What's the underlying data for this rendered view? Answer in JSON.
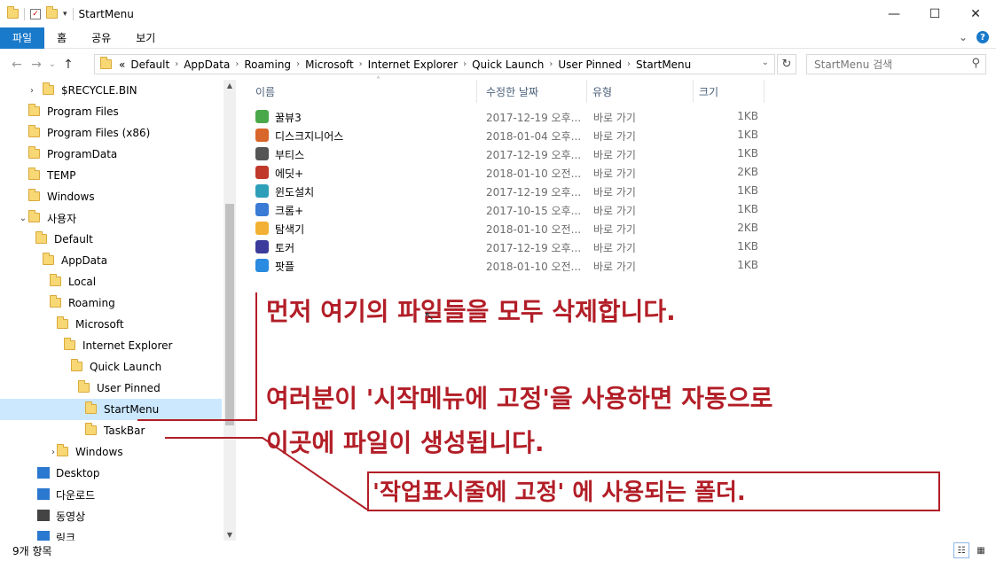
{
  "window": {
    "title": "StartMenu",
    "controls": {
      "minimize": "—",
      "maximize": "☐",
      "close": "✕"
    }
  },
  "ribbon": {
    "tabs": [
      "파일",
      "홈",
      "공유",
      "보기"
    ],
    "help": "?",
    "expand": "⌄"
  },
  "nav": {
    "back": "←",
    "forward": "→",
    "history": "⌄",
    "up": "↑",
    "prefix": "«",
    "breadcrumb": [
      "Default",
      "AppData",
      "Roaming",
      "Microsoft",
      "Internet Explorer",
      "Quick Launch",
      "User Pinned",
      "StartMenu"
    ],
    "refresh": "↻",
    "search_placeholder": "StartMenu 검색"
  },
  "tree": [
    {
      "label": "$RECYCLE.BIN",
      "chevron": "›",
      "kind": "folder"
    },
    {
      "label": "Program Files",
      "chevron": "›",
      "kind": "folder"
    },
    {
      "label": "Program Files (x86)",
      "chevron": "›",
      "kind": "folder"
    },
    {
      "label": "ProgramData",
      "chevron": "›",
      "kind": "folder"
    },
    {
      "label": "TEMP",
      "chevron": "›",
      "kind": "folder"
    },
    {
      "label": "Windows",
      "chevron": "›",
      "kind": "folder"
    },
    {
      "label": "사용자",
      "chevron": "⌄",
      "kind": "folder"
    },
    {
      "label": "Default",
      "chevron": "⌄",
      "kind": "folder"
    },
    {
      "label": "AppData",
      "chevron": "⌄",
      "kind": "folder"
    },
    {
      "label": "Local",
      "chevron": "›",
      "kind": "folder"
    },
    {
      "label": "Roaming",
      "chevron": "⌄",
      "kind": "folder"
    },
    {
      "label": "Microsoft",
      "chevron": "⌄",
      "kind": "folder"
    },
    {
      "label": "Internet Explorer",
      "chevron": "⌄",
      "kind": "folder"
    },
    {
      "label": "Quick Launch",
      "chevron": "⌄",
      "kind": "folder"
    },
    {
      "label": "User Pinned",
      "chevron": "⌄",
      "kind": "folder-open"
    },
    {
      "label": "StartMenu",
      "chevron": "",
      "kind": "folder",
      "selected": true
    },
    {
      "label": "TaskBar",
      "chevron": "",
      "kind": "folder"
    },
    {
      "label": "Windows",
      "chevron": "›",
      "kind": "folder"
    },
    {
      "label": "Desktop",
      "chevron": "",
      "kind": "desktop"
    },
    {
      "label": "다운로드",
      "chevron": "",
      "kind": "download"
    },
    {
      "label": "동영상",
      "chevron": "",
      "kind": "video"
    },
    {
      "label": "링크",
      "chevron": "",
      "kind": "link"
    }
  ],
  "columns": {
    "name": "이름",
    "date": "수정한 날짜",
    "type": "유형",
    "size": "크기"
  },
  "files": [
    {
      "name": "꿀뷰3",
      "date": "2017-12-19 오후...",
      "type": "바로 가기",
      "size": "1KB",
      "color": "#4aa84a"
    },
    {
      "name": "디스크지니어스",
      "date": "2018-01-04 오후...",
      "type": "바로 가기",
      "size": "1KB",
      "color": "#d9662a"
    },
    {
      "name": "부티스",
      "date": "2017-12-19 오후...",
      "type": "바로 가기",
      "size": "1KB",
      "color": "#555555"
    },
    {
      "name": "에딧+",
      "date": "2018-01-10 오전...",
      "type": "바로 가기",
      "size": "2KB",
      "color": "#c0392b"
    },
    {
      "name": "윈도설치",
      "date": "2017-12-19 오후...",
      "type": "바로 가기",
      "size": "1KB",
      "color": "#2e9fb8"
    },
    {
      "name": "크롬+",
      "date": "2017-10-15 오후...",
      "type": "바로 가기",
      "size": "1KB",
      "color": "#3a7bd5"
    },
    {
      "name": "탐색기",
      "date": "2018-01-10 오전...",
      "type": "바로 가기",
      "size": "2KB",
      "color": "#f2b134"
    },
    {
      "name": "토커",
      "date": "2017-12-19 오후...",
      "type": "바로 가기",
      "size": "1KB",
      "color": "#3b3b9c"
    },
    {
      "name": "팟플",
      "date": "2018-01-10 오전...",
      "type": "바로 가기",
      "size": "1KB",
      "color": "#2a8be0"
    }
  ],
  "status": {
    "count": "9개 항목"
  },
  "annotations": {
    "line1": "먼저 여기의 파일들을 모두 삭제합니다.",
    "line2": "여러분이 '시작메뉴에 고정'을 사용하면 자동으로",
    "line3": "이곳에 파일이 생성됩니다.",
    "line4": "'작업표시줄에 고정' 에 사용되는 폴더."
  }
}
